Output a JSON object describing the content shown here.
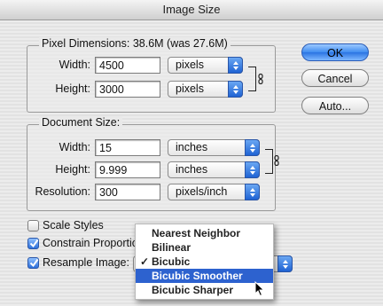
{
  "window": {
    "title": "Image Size"
  },
  "pixel_dimensions": {
    "title": "Pixel Dimensions:  38.6M (was 27.6M)",
    "width": {
      "label": "Width:",
      "value": "4500",
      "unit": "pixels"
    },
    "height": {
      "label": "Height:",
      "value": "3000",
      "unit": "pixels"
    }
  },
  "document_size": {
    "title": "Document Size:",
    "width": {
      "label": "Width:",
      "value": "15",
      "unit": "inches"
    },
    "height": {
      "label": "Height:",
      "value": "9.999",
      "unit": "inches"
    },
    "resolution": {
      "label": "Resolution:",
      "value": "300",
      "unit": "pixels/inch"
    }
  },
  "buttons": {
    "ok": "OK",
    "cancel": "Cancel",
    "auto": "Auto..."
  },
  "options": {
    "scale_styles": {
      "label": "Scale Styles",
      "checked": false
    },
    "constrain": {
      "label": "Constrain Proportio",
      "checked": true
    },
    "resample": {
      "label": "Resample Image:",
      "checked": true
    }
  },
  "resample_menu": {
    "items": [
      "Nearest Neighbor",
      "Bilinear",
      "Bicubic",
      "Bicubic Smoother",
      "Bicubic Sharper"
    ],
    "checked": "Bicubic",
    "highlighted": "Bicubic Smoother"
  },
  "colors": {
    "accent": "#2d62cf",
    "button_blue": "#3f8cf0"
  }
}
